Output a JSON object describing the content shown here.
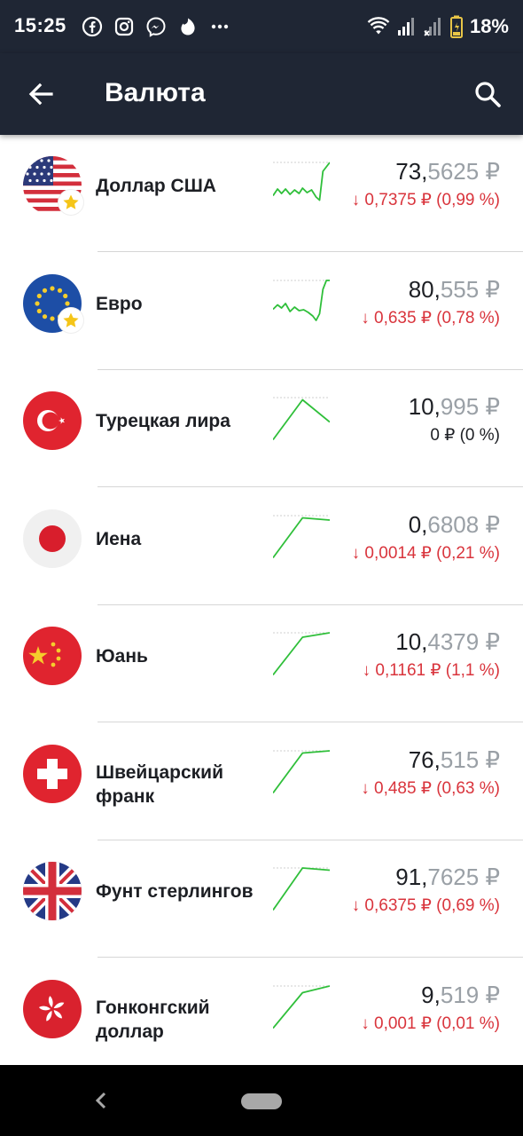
{
  "status": {
    "time": "15:25",
    "battery": "18%",
    "colors": {
      "bar": "#1f2634",
      "battery": "#e8c547"
    }
  },
  "header": {
    "title": "Валюта"
  },
  "colors": {
    "up_line": "#2fbf3a",
    "down": "#d9343c",
    "muted": "#9aa0a6"
  },
  "currencies": [
    {
      "name": "Доллар США",
      "flag": "us-flag",
      "favorite": true,
      "price_int": "73,",
      "price_frac": "5625",
      "rub": " ₽",
      "change": "↓ 0,7375 ₽ (0,99 %)",
      "direction": "down",
      "trend": [
        [
          0,
          0.75
        ],
        [
          0.08,
          0.6
        ],
        [
          0.15,
          0.7
        ],
        [
          0.22,
          0.6
        ],
        [
          0.3,
          0.72
        ],
        [
          0.38,
          0.62
        ],
        [
          0.46,
          0.7
        ],
        [
          0.52,
          0.58
        ],
        [
          0.6,
          0.68
        ],
        [
          0.68,
          0.62
        ],
        [
          0.76,
          0.78
        ],
        [
          0.82,
          0.85
        ],
        [
          0.88,
          0.2
        ],
        [
          1,
          0.0
        ]
      ]
    },
    {
      "name": "Евро",
      "flag": "eu-flag",
      "favorite": true,
      "price_int": "80,",
      "price_frac": "555",
      "rub": " ₽",
      "change": "↓ 0,635 ₽ (0,78 %)",
      "direction": "down",
      "trend": [
        [
          0,
          0.65
        ],
        [
          0.08,
          0.55
        ],
        [
          0.15,
          0.62
        ],
        [
          0.22,
          0.52
        ],
        [
          0.3,
          0.7
        ],
        [
          0.38,
          0.6
        ],
        [
          0.46,
          0.68
        ],
        [
          0.54,
          0.66
        ],
        [
          0.62,
          0.72
        ],
        [
          0.7,
          0.8
        ],
        [
          0.76,
          0.9
        ],
        [
          0.82,
          0.75
        ],
        [
          0.88,
          0.2
        ],
        [
          0.94,
          0.0
        ],
        [
          1,
          0.0
        ]
      ]
    },
    {
      "name": "Турецкая лира",
      "flag": "tr-flag",
      "favorite": false,
      "price_int": "10,",
      "price_frac": "995",
      "rub": " ₽",
      "change": "0 ₽ (0 %)",
      "direction": "zero",
      "trend": [
        [
          0,
          0.95
        ],
        [
          0.52,
          0.05
        ],
        [
          1,
          0.55
        ]
      ]
    },
    {
      "name": "Иена",
      "flag": "jp-flag",
      "favorite": false,
      "price_int": "0,",
      "price_frac": "6808",
      "rub": " ₽",
      "change": "↓ 0,0014 ₽ (0,21 %)",
      "direction": "down",
      "trend": [
        [
          0,
          0.95
        ],
        [
          0.52,
          0.05
        ],
        [
          1,
          0.1
        ]
      ]
    },
    {
      "name": "Юань",
      "flag": "cn-flag",
      "favorite": false,
      "price_int": "10,",
      "price_frac": "4379",
      "rub": " ₽",
      "change": "↓ 0,1161 ₽ (1,1 %)",
      "direction": "down",
      "trend": [
        [
          0,
          0.95
        ],
        [
          0.52,
          0.1
        ],
        [
          1,
          0.0
        ]
      ]
    },
    {
      "name": "Швейцарский франк",
      "flag": "ch-flag",
      "favorite": false,
      "price_int": "76,",
      "price_frac": "515",
      "rub": " ₽",
      "change": "↓ 0,485 ₽ (0,63 %)",
      "direction": "down",
      "trend": [
        [
          0,
          0.95
        ],
        [
          0.52,
          0.05
        ],
        [
          1,
          0.0
        ]
      ]
    },
    {
      "name": "Фунт стерлингов",
      "flag": "gb-flag",
      "favorite": false,
      "price_int": "91,",
      "price_frac": "7625",
      "rub": " ₽",
      "change": "↓ 0,6375 ₽ (0,69 %)",
      "direction": "down",
      "trend": [
        [
          0,
          0.95
        ],
        [
          0.52,
          0.0
        ],
        [
          1,
          0.05
        ]
      ]
    },
    {
      "name": "Гонконгский доллар",
      "flag": "hk-flag",
      "favorite": false,
      "price_int": "9,",
      "price_frac": "519",
      "rub": " ₽",
      "change": "↓ 0,001 ₽ (0,01 %)",
      "direction": "down",
      "trend": [
        [
          0,
          0.95
        ],
        [
          0.52,
          0.15
        ],
        [
          1,
          0.0
        ]
      ]
    }
  ]
}
